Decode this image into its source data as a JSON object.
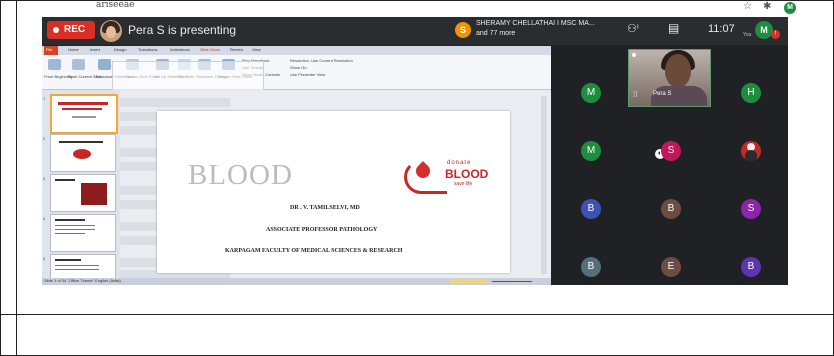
{
  "page": {
    "top_chars": "ariseeae",
    "corner_icons": [
      "star-icon",
      "puzzle-icon",
      "account-avatar-icon"
    ],
    "corner_avatar_letter": "M"
  },
  "meet": {
    "rec_label": "REC",
    "presenter_title": "Pera S is presenting",
    "people_line1": "SHERAMY CHELLATHAI I MSC MA...",
    "people_line2": "and 77 more",
    "people_initial": "S",
    "people_count_icon": "people-icon",
    "chat_icon": "chat-icon",
    "time": "11:07",
    "you_label": "You",
    "you_initial": "M",
    "badge": "!"
  },
  "slide": {
    "big_word": "BLOOD",
    "donate_small": "donate",
    "donate_big": "BLOOD",
    "donate_save": "save life",
    "author": "DR . V. TAMILSELVI, MD",
    "role": "ASSOCIATE PROFESSOR PATHOLOGY",
    "institution": "KARPAGAM FACULTY OF MEDICAL SCIENCES & RESEARCH"
  },
  "ppt": {
    "tabs": [
      "File",
      "Home",
      "Insert",
      "Design",
      "Transitions",
      "Animations",
      "Slide Show",
      "Review",
      "View"
    ],
    "ribbon_buttons": [
      "From Beginning",
      "From Current Slide",
      "Broadcast Slide Show",
      "Custom Slide Show",
      "Set Up Slide Show",
      "Hide Slide",
      "Rehearse Timings",
      "Record Slide Show"
    ],
    "ribbon_options": [
      "Play Narrations",
      "Use Timings",
      "Show Media Controls",
      "Resolution: Use Current Resolution",
      "Show On:",
      "Use Presenter View"
    ],
    "slide_numbers": [
      "1",
      "2",
      "3",
      "4",
      "5"
    ],
    "status": "Slide 1 of 34   \"Office Theme\"   English (India)"
  },
  "participants": [
    {
      "initial": "M",
      "color": "#1e8e3e"
    },
    {
      "initial": "H",
      "color": "#1e8e3e"
    },
    {
      "initial": "M",
      "color": "#1e8e3e"
    },
    {
      "initial": "S",
      "color": "#c2185b"
    },
    {
      "initial": "B",
      "color": "#3f51b5"
    },
    {
      "initial": "B",
      "color": "#6d4c41"
    },
    {
      "initial": "S",
      "color": "#8e24aa"
    },
    {
      "initial": "B",
      "color": "#546e7a"
    },
    {
      "initial": "E",
      "color": "#6d4c41"
    },
    {
      "initial": "B",
      "color": "#5e35b1"
    }
  ],
  "video_tile": {
    "name": "Pera S",
    "mic_icon": "mic-active-icon"
  }
}
